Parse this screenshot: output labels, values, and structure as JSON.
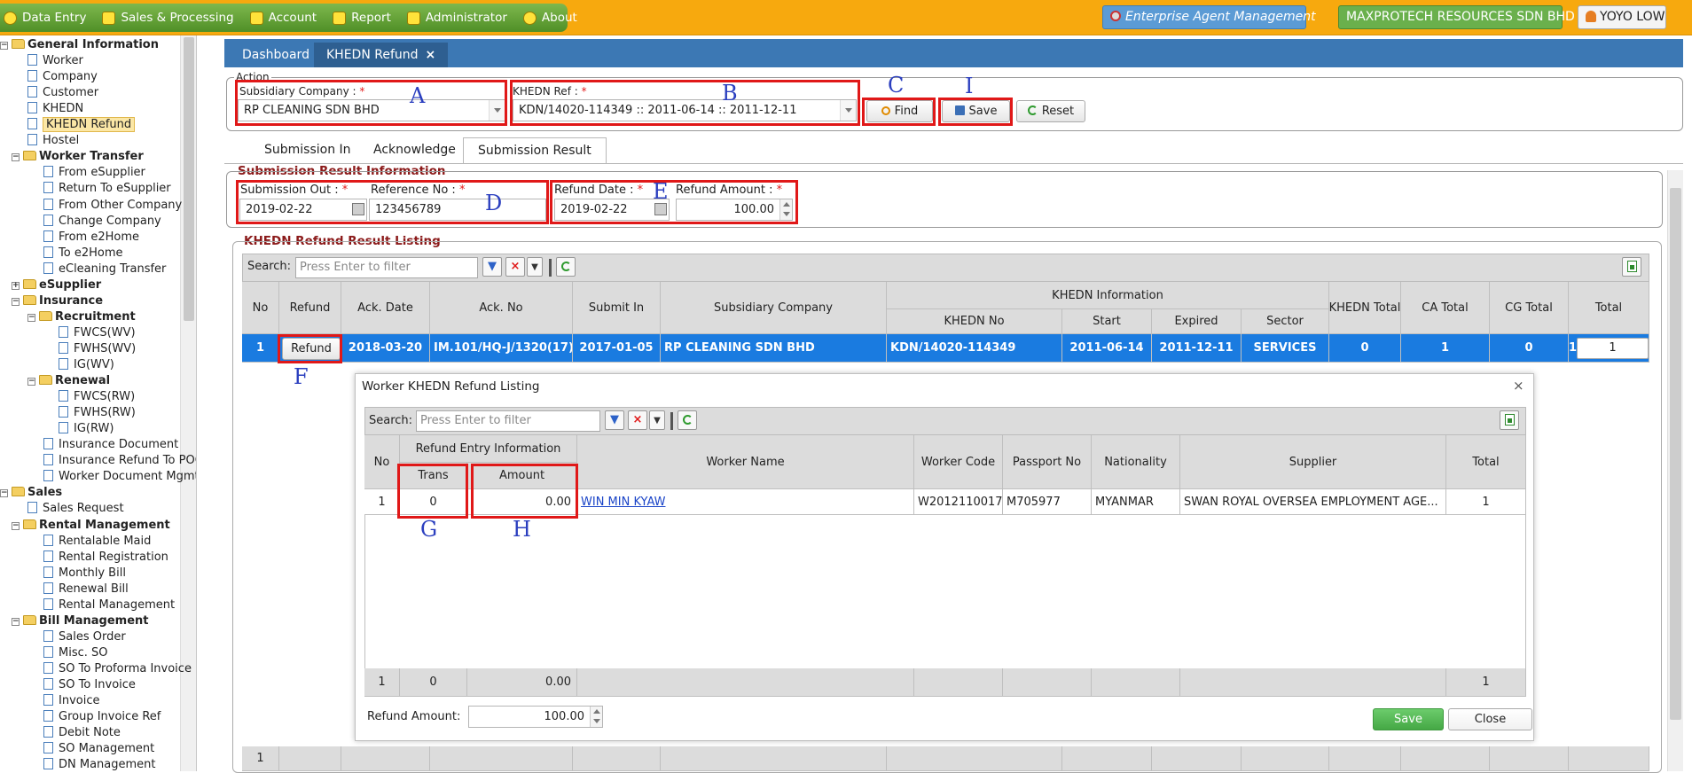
{
  "top_menu": {
    "items": [
      {
        "label": "Data Entry",
        "icon": "info-circle-icon"
      },
      {
        "label": "Sales & Processing",
        "icon": "cart-icon"
      },
      {
        "label": "Account",
        "icon": "briefcase-icon"
      },
      {
        "label": "Report",
        "icon": "table-icon"
      },
      {
        "label": "Administrator",
        "icon": "admin-users-icon"
      },
      {
        "label": "About",
        "icon": "help-circle-icon"
      }
    ],
    "enterprise_label": "Enterprise Agent Management",
    "company_label": "MAXPROTECH RESOURCES SDN BHD",
    "user_label": "YOYO LOW"
  },
  "tree": [
    {
      "label": "General Information",
      "level": 0,
      "type": "folder",
      "expanded": true,
      "bold": true
    },
    {
      "label": "Worker",
      "level": 1,
      "type": "doc"
    },
    {
      "label": "Company",
      "level": 1,
      "type": "doc"
    },
    {
      "label": "Customer",
      "level": 1,
      "type": "doc"
    },
    {
      "label": "KHEDN",
      "level": 1,
      "type": "doc"
    },
    {
      "label": "KHEDN Refund",
      "level": 1,
      "type": "doc",
      "selected": true
    },
    {
      "label": "Hostel",
      "level": 1,
      "type": "doc"
    },
    {
      "label": "Worker Transfer",
      "level": 1,
      "type": "folder",
      "expanded": true,
      "bold": true
    },
    {
      "label": "From eSupplier",
      "level": 2,
      "type": "doc"
    },
    {
      "label": "Return To eSupplier",
      "level": 2,
      "type": "doc"
    },
    {
      "label": "From Other Company",
      "level": 2,
      "type": "doc"
    },
    {
      "label": "Change Company",
      "level": 2,
      "type": "doc"
    },
    {
      "label": "From e2Home",
      "level": 2,
      "type": "doc"
    },
    {
      "label": "To e2Home",
      "level": 2,
      "type": "doc"
    },
    {
      "label": "eCleaning Transfer",
      "level": 2,
      "type": "doc"
    },
    {
      "label": "eSupplier",
      "level": 1,
      "type": "folder",
      "expanded": false,
      "bold": true
    },
    {
      "label": "Insurance",
      "level": 1,
      "type": "folder",
      "expanded": true,
      "bold": true
    },
    {
      "label": "Recruitment",
      "level": 2,
      "type": "folder",
      "expanded": true,
      "bold": true
    },
    {
      "label": "FWCS(WV)",
      "level": 3,
      "type": "doc"
    },
    {
      "label": "FWHS(WV)",
      "level": 3,
      "type": "doc"
    },
    {
      "label": "IG(WV)",
      "level": 3,
      "type": "doc"
    },
    {
      "label": "Renewal",
      "level": 2,
      "type": "folder",
      "expanded": true,
      "bold": true
    },
    {
      "label": "FWCS(RW)",
      "level": 3,
      "type": "doc"
    },
    {
      "label": "FWHS(RW)",
      "level": 3,
      "type": "doc"
    },
    {
      "label": "IG(RW)",
      "level": 3,
      "type": "doc"
    },
    {
      "label": "Insurance Document",
      "level": 2,
      "type": "doc"
    },
    {
      "label": "Insurance Refund To POCN",
      "level": 2,
      "type": "doc"
    },
    {
      "label": "Worker Document Mgmt",
      "level": 2,
      "type": "doc"
    },
    {
      "label": "Sales",
      "level": 0,
      "type": "folder",
      "expanded": true,
      "bold": true
    },
    {
      "label": "Sales Request",
      "level": 1,
      "type": "doc"
    },
    {
      "label": "Rental Management",
      "level": 1,
      "type": "folder",
      "expanded": true,
      "bold": true
    },
    {
      "label": "Rentalable Maid",
      "level": 2,
      "type": "doc"
    },
    {
      "label": "Rental Registration",
      "level": 2,
      "type": "doc"
    },
    {
      "label": "Monthly Bill",
      "level": 2,
      "type": "doc"
    },
    {
      "label": "Renewal Bill",
      "level": 2,
      "type": "doc"
    },
    {
      "label": "Rental Management",
      "level": 2,
      "type": "doc"
    },
    {
      "label": "Bill Management",
      "level": 1,
      "type": "folder",
      "expanded": true,
      "bold": true
    },
    {
      "label": "Sales Order",
      "level": 2,
      "type": "doc"
    },
    {
      "label": "Misc. SO",
      "level": 2,
      "type": "doc"
    },
    {
      "label": "SO To Proforma Invoice",
      "level": 2,
      "type": "doc"
    },
    {
      "label": "SO To Invoice",
      "level": 2,
      "type": "doc"
    },
    {
      "label": "Invoice",
      "level": 2,
      "type": "doc"
    },
    {
      "label": "Group Invoice Ref",
      "level": 2,
      "type": "doc"
    },
    {
      "label": "Debit Note",
      "level": 2,
      "type": "doc"
    },
    {
      "label": "SO Management",
      "level": 2,
      "type": "doc"
    },
    {
      "label": "DN Management",
      "level": 2,
      "type": "doc"
    }
  ],
  "tabs": {
    "dashboard": "Dashboard",
    "active": "KHEDN Refund",
    "close": "×"
  },
  "action": {
    "legend": "Action",
    "subsidiary_label": "Subsidiary Company :",
    "subsidiary_value": "RP CLEANING SDN BHD",
    "khedn_ref_label": "KHEDN Ref :",
    "khedn_ref_value": "KDN/14020-114349 :: 2011-06-14 :: 2011-12-11",
    "required_mark": "*",
    "find": "Find",
    "save": "Save",
    "reset": "Reset"
  },
  "subtabs": [
    "Submission In",
    "Acknowledge",
    "Submission Result"
  ],
  "result_info": {
    "title": "Submission Result Information",
    "submission_out_label": "Submission Out :",
    "submission_out_value": "2019-02-22",
    "reference_no_label": "Reference No :",
    "reference_no_value": "123456789",
    "refund_date_label": "Refund Date :",
    "refund_date_value": "2019-02-22",
    "refund_amount_label": "Refund Amount :",
    "refund_amount_value": "100.00"
  },
  "listing": {
    "title": "KHEDN Refund Result Listing",
    "search_label": "Search:",
    "search_placeholder": "Press Enter to filter",
    "group_header": "KHEDN Information",
    "headers": [
      "No",
      "Refund",
      "Ack. Date",
      "Ack. No",
      "Submit In",
      "Subsidiary Company",
      "KHEDN No",
      "Start",
      "Expired",
      "Sector",
      "KHEDN Total",
      "CA Total",
      "CG Total",
      "Total"
    ],
    "row": {
      "no": "1",
      "refund_btn": "Refund",
      "ack_date": "2018-03-20",
      "ack_no": "IM.101/HQ-J/1320(17)",
      "submit_in": "2017-01-05",
      "subsidiary": "RP CLEANING SDN BHD",
      "khedn_no": "KDN/14020-114349",
      "start": "2011-06-14",
      "expired": "2011-12-11",
      "sector": "SERVICES",
      "khedn_total": "0",
      "ca_total": "1",
      "cg_total": "0",
      "total": "1"
    },
    "footer_no": "1"
  },
  "dialog": {
    "title": "Worker KHEDN Refund Listing",
    "close": "×",
    "search_label": "Search:",
    "search_placeholder": "Press Enter to filter",
    "group_header": "Refund Entry Information",
    "headers": [
      "No",
      "Trans",
      "Amount",
      "Worker Name",
      "Worker Code",
      "Passport No",
      "Nationality",
      "Supplier",
      "Total"
    ],
    "row": {
      "no": "1",
      "trans": "0",
      "amount": "0.00",
      "worker_name": "WIN MIN KYAW",
      "worker_code": "W2012110017",
      "passport": "M705977",
      "nationality": "MYANMAR",
      "supplier": "SWAN ROYAL OVERSEA EMPLOYMENT AGE...",
      "total": "1"
    },
    "footer": {
      "no": "1",
      "trans": "0",
      "amount": "0.00",
      "total": "1"
    },
    "refund_amount_label": "Refund Amount:",
    "refund_amount_value": "100.00",
    "save": "Save",
    "close_btn": "Close"
  },
  "annotations": [
    "A",
    "B",
    "C",
    "I",
    "D",
    "E",
    "F",
    "G",
    "H"
  ]
}
